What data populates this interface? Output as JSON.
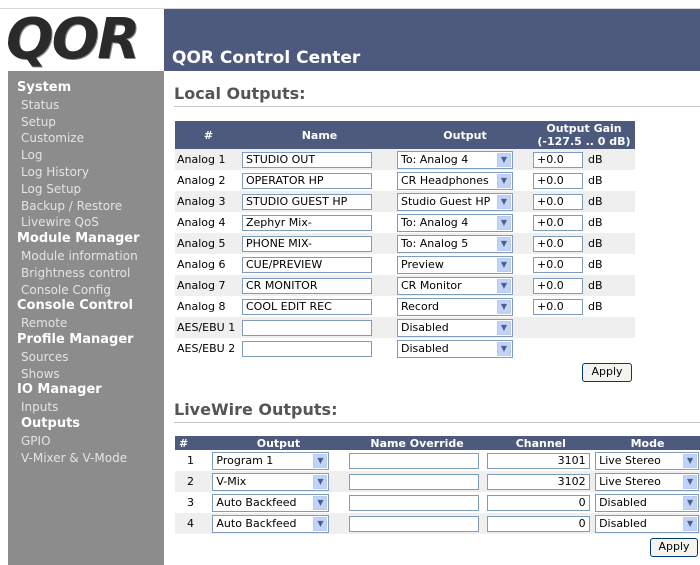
{
  "app": {
    "logo_text": "QOR",
    "title": "QOR Control Center"
  },
  "sidebar": {
    "sections": [
      {
        "title": "System",
        "items": [
          "Status",
          "Setup",
          "Customize",
          "Log",
          "Log History",
          "Log Setup",
          "Backup / Restore",
          "Livewire QoS"
        ]
      },
      {
        "title": "Module Manager",
        "items": [
          "Module information",
          "Brightness control",
          "Console Config"
        ]
      },
      {
        "title": "Console Control",
        "items": [
          "Remote"
        ]
      },
      {
        "title": "Profile Manager",
        "items": [
          "Sources",
          "Shows"
        ]
      },
      {
        "title": "IO Manager",
        "items": [
          "Inputs",
          "Outputs",
          "GPIO",
          "V-Mixer & V-Mode"
        ]
      }
    ],
    "active_item": "Outputs"
  },
  "local_outputs": {
    "title": "Local Outputs:",
    "headers": {
      "num": "#",
      "name": "Name",
      "output": "Output",
      "gain": "Output Gain",
      "gain_range": "(-127.5 .. 0 dB)"
    },
    "gain_unit": "dB",
    "rows": [
      {
        "label": "Analog 1",
        "name": "STUDIO OUT",
        "output": "To: Analog 4",
        "gain": "+0.0"
      },
      {
        "label": "Analog 2",
        "name": "OPERATOR HP",
        "output": "CR Headphones",
        "gain": "+0.0"
      },
      {
        "label": "Analog 3",
        "name": "STUDIO GUEST HP",
        "output": "Studio Guest HP",
        "gain": "+0.0"
      },
      {
        "label": "Analog 4",
        "name": "Zephyr Mix-",
        "output": "To: Analog 4",
        "gain": "+0.0"
      },
      {
        "label": "Analog 5",
        "name": "PHONE MIX-",
        "output": "To: Analog 5",
        "gain": "+0.0"
      },
      {
        "label": "Analog 6",
        "name": "CUE/PREVIEW",
        "output": "Preview",
        "gain": "+0.0"
      },
      {
        "label": "Analog 7",
        "name": "CR MONITOR",
        "output": "CR Monitor",
        "gain": "+0.0"
      },
      {
        "label": "Analog 8",
        "name": "COOL EDIT REC",
        "output": "Record",
        "gain": "+0.0"
      },
      {
        "label": "AES/EBU 1",
        "name": "",
        "output": "Disabled",
        "gain": null
      },
      {
        "label": "AES/EBU 2",
        "name": "",
        "output": "Disabled",
        "gain": null
      }
    ],
    "apply_label": "Apply"
  },
  "livewire_outputs": {
    "title": "LiveWire Outputs:",
    "headers": {
      "num": "#",
      "output": "Output",
      "name_override": "Name Override",
      "channel": "Channel",
      "mode": "Mode"
    },
    "rows": [
      {
        "num": "1",
        "output": "Program 1",
        "name_override": "",
        "channel": "3101",
        "mode": "Live Stereo"
      },
      {
        "num": "2",
        "output": "V-Mix",
        "name_override": "",
        "channel": "3102",
        "mode": "Live Stereo"
      },
      {
        "num": "3",
        "output": "Auto Backfeed",
        "name_override": "",
        "channel": "0",
        "mode": "Disabled"
      },
      {
        "num": "4",
        "output": "Auto Backfeed",
        "name_override": "",
        "channel": "0",
        "mode": "Disabled"
      }
    ],
    "apply_label": "Apply"
  },
  "colors": {
    "header_bar": "#4d5a7e",
    "sidebar": "#8c8c8c",
    "row_alt": "#efefef"
  },
  "icons": {
    "dropdown": "chevron-down-icon"
  }
}
